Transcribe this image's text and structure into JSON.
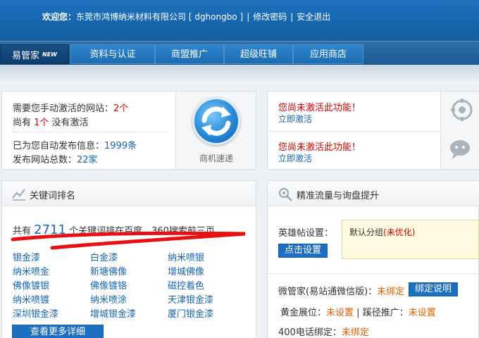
{
  "header": {
    "welcome_label": "欢迎您：",
    "company": "东莞市鸿博纳米材料有限公司 [ dghongbo ]",
    "change_password": "修改密码",
    "logout": "安全退出",
    "separator": "|"
  },
  "nav": {
    "items": [
      {
        "label": "易管家",
        "badge": "NEW"
      },
      {
        "label": "资料与认证"
      },
      {
        "label": "商盟推广"
      },
      {
        "label": "超级旺铺"
      },
      {
        "label": "应用商店"
      }
    ]
  },
  "activation": {
    "manual_prefix": "需要您手动激活的网站：",
    "manual_count": "2个",
    "pending_prefix": "尚有 ",
    "pending_count": "1个",
    "pending_suffix": " 没有激活",
    "auto_prefix": "已为您自动发布信息：",
    "auto_count": "1999条",
    "sites_prefix": "发布网站总数：",
    "sites_count": "22家",
    "logo_label": "商机速递"
  },
  "right_alerts": [
    {
      "warning": "您尚未激活此功能！",
      "link": "立即激活"
    },
    {
      "warning": "您尚未激活此功能！",
      "link": "立即激活"
    }
  ],
  "keywords": {
    "title": "关键词排名",
    "summary_prefix": "共有 ",
    "summary_count": "2711",
    "summary_suffix": " 个关键词排在百度、360搜索前三页。",
    "items": [
      "银金漆",
      "白金漆",
      "纳米喷银",
      "纳米喷金",
      "新塘佛像",
      "增城佛像",
      "佛像镀银",
      "佛像镀铬",
      "磁控着色",
      "纳米喷镀",
      "纳米喷涂",
      "天津银金漆",
      "深圳银金漆",
      "增城银金漆",
      "厦门银金漆"
    ],
    "more_button": "查看更多详细"
  },
  "traffic": {
    "title": "精准流量与询盘提升",
    "hero_label": "英雄帖设置：",
    "hero_button": "点击设置",
    "default_group": "默认分组",
    "not_optimized": "(未优化)",
    "wechat_label": "微管家(易站通微信版)：",
    "wechat_status": "未绑定",
    "bind_button": "绑定说明",
    "gold_label": "黄金展位：",
    "gold_status": "未设置",
    "divider": " | ",
    "path_label": "蹊径推广：",
    "path_status": "未设置",
    "phone_label": "400电话绑定：",
    "phone_status": "未绑定"
  }
}
